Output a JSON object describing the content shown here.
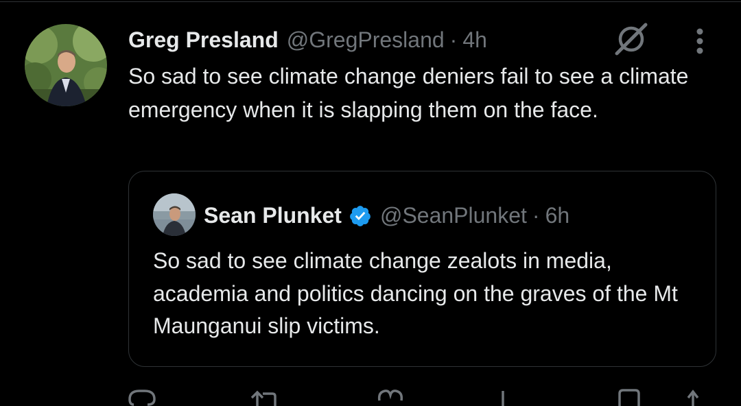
{
  "tweet": {
    "author_name": "Greg Presland",
    "author_handle": "@GregPresland",
    "separator": "·",
    "time": "4h",
    "text": "So sad to see climate change deniers fail to see a climate emergency when it is slapping them on the face."
  },
  "quote": {
    "author_name": "Sean Plunket",
    "author_handle": "@SeanPlunket",
    "separator": "·",
    "time": "6h",
    "verified": true,
    "text": "So sad to see climate change zealots in media, academia and politics dancing on the graves of the Mt Maunganui slip victims."
  },
  "actions": {
    "reply_count": "",
    "repost_count": "",
    "like_count": "",
    "views_count": ""
  },
  "icons": {
    "grok": "grok-icon",
    "more": "more-vertical-icon",
    "verified": "verified-badge-icon",
    "reply": "reply-icon",
    "repost": "repost-icon",
    "like": "like-icon",
    "views": "views-icon",
    "bookmark": "bookmark-icon",
    "share": "share-icon"
  },
  "colors": {
    "background": "#000000",
    "text": "#e7e9ea",
    "secondary": "#71767b",
    "border": "#2f3336",
    "verified": "#1d9bf0"
  }
}
